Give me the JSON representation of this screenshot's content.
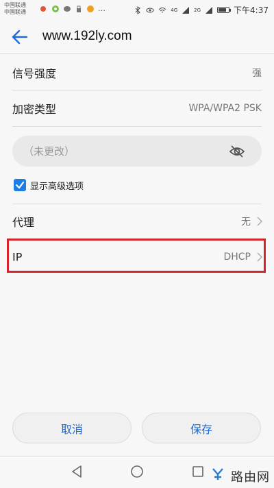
{
  "status_bar": {
    "carrier_1": "中国联通",
    "carrier_2": "中国联通",
    "time": "下午4:37",
    "battery_level": 0.8,
    "signal_label_1": "4G",
    "signal_label_2": "2G"
  },
  "header": {
    "title": "www.192ly.com"
  },
  "rows": {
    "signal": {
      "label": "信号强度",
      "value": "强"
    },
    "encryption": {
      "label": "加密类型",
      "value": "WPA/WPA2 PSK"
    },
    "proxy": {
      "label": "代理",
      "value": "无"
    },
    "ip": {
      "label": "IP",
      "value": "DHCP"
    }
  },
  "password": {
    "placeholder": "（未更改）"
  },
  "advanced": {
    "label": "显示高级选项",
    "checked": true
  },
  "buttons": {
    "cancel": "取消",
    "save": "保存"
  },
  "watermark": {
    "text": "路由网",
    "logo": "yo"
  },
  "colors": {
    "accent": "#1e7de2",
    "highlight": "#d3232b"
  }
}
